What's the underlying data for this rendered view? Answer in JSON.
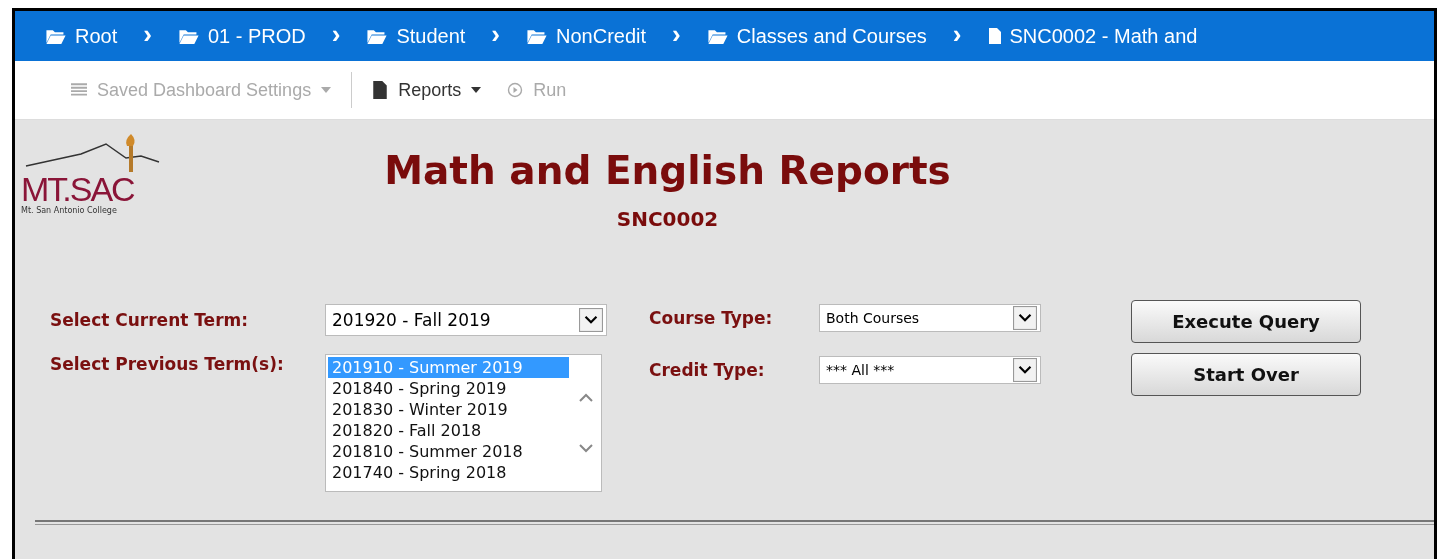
{
  "breadcrumbs": [
    {
      "label": "Root",
      "kind": "folder"
    },
    {
      "label": "01 - PROD",
      "kind": "folder"
    },
    {
      "label": "Student",
      "kind": "folder"
    },
    {
      "label": "NonCredit",
      "kind": "folder"
    },
    {
      "label": "Classes and Courses",
      "kind": "folder"
    },
    {
      "label": "SNC0002 - Math and",
      "kind": "file"
    }
  ],
  "breadcrumb_separator": "›",
  "toolbar": [
    {
      "label": "Saved Dashboard Settings",
      "kind": "list",
      "disabled": true,
      "dropdown": true
    },
    {
      "label": "Reports",
      "kind": "file",
      "disabled": false,
      "dropdown": true
    },
    {
      "label": "Run",
      "kind": "run",
      "disabled": true,
      "dropdown": false
    }
  ],
  "logo": {
    "name": "MT.SAC",
    "subtitle": "Mt. San Antonio College"
  },
  "report": {
    "title": "Math and English Reports",
    "code": "SNC0002"
  },
  "current_term": {
    "label": "Select Current Term:",
    "value": "201920 - Fall 2019"
  },
  "previous_terms": {
    "label": "Select Previous Term(s):",
    "options": [
      {
        "label": "201910 - Summer 2019",
        "selected": true
      },
      {
        "label": "201840 - Spring 2019",
        "selected": false
      },
      {
        "label": "201830 - Winter 2019",
        "selected": false
      },
      {
        "label": "201820 - Fall 2018",
        "selected": false
      },
      {
        "label": "201810 - Summer 2018",
        "selected": false
      },
      {
        "label": "201740 - Spring 2018",
        "selected": false
      }
    ]
  },
  "course_type": {
    "label": "Course Type:",
    "value": "Both Courses"
  },
  "credit_type": {
    "label": "Credit Type:",
    "value": "*** All ***"
  },
  "buttons": [
    "Execute Query",
    "Start Over"
  ]
}
